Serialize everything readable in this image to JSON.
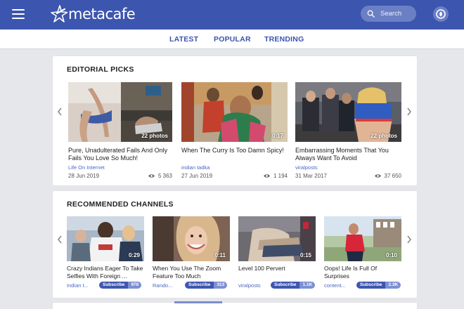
{
  "header": {
    "logo_text": "metacafe",
    "search_label": "Search",
    "brand_color": "#3c55ae"
  },
  "nav": {
    "tabs": [
      {
        "label": "LATEST"
      },
      {
        "label": "POPULAR"
      },
      {
        "label": "TRENDING"
      }
    ]
  },
  "editorial": {
    "title": "EDITORIAL PICKS",
    "items": [
      {
        "title": "Pure, Unadulterated Fails And Only Fails You Love So Much!",
        "source": "Life On Internet",
        "date": "28 Jun 2019",
        "views": "5 363",
        "badge": "22 photos"
      },
      {
        "title": "When The Curry Is Too Damn Spicy!",
        "source": "indian tadka",
        "date": "27 Jun 2019",
        "views": "1 194",
        "badge": "0:17"
      },
      {
        "title": "Embarrassing Moments That You Always Want To Avoid",
        "source": "viralposts",
        "date": "31 Mar 2017",
        "views": "37 650",
        "badge": "22 photos"
      }
    ]
  },
  "recommended": {
    "title": "RECOMMENDED CHANNELS",
    "subscribe_label": "Subscribe",
    "items": [
      {
        "title": "Crazy Indians Eager To Take Selfies With Foreign ...",
        "channel": "Indian t...",
        "count": "976",
        "badge": "0:29"
      },
      {
        "title": "When You Use The Zoom Feature Too Much",
        "channel": "Rando...",
        "count": "313",
        "badge": "0:11"
      },
      {
        "title": "Level 100 Pervert",
        "channel": "viralposts",
        "count": "1.1K",
        "badge": "0:15"
      },
      {
        "title": "Oops! Life Is Full Of Surprises",
        "channel": "content...",
        "count": "2.3K",
        "badge": "0:10"
      }
    ]
  }
}
